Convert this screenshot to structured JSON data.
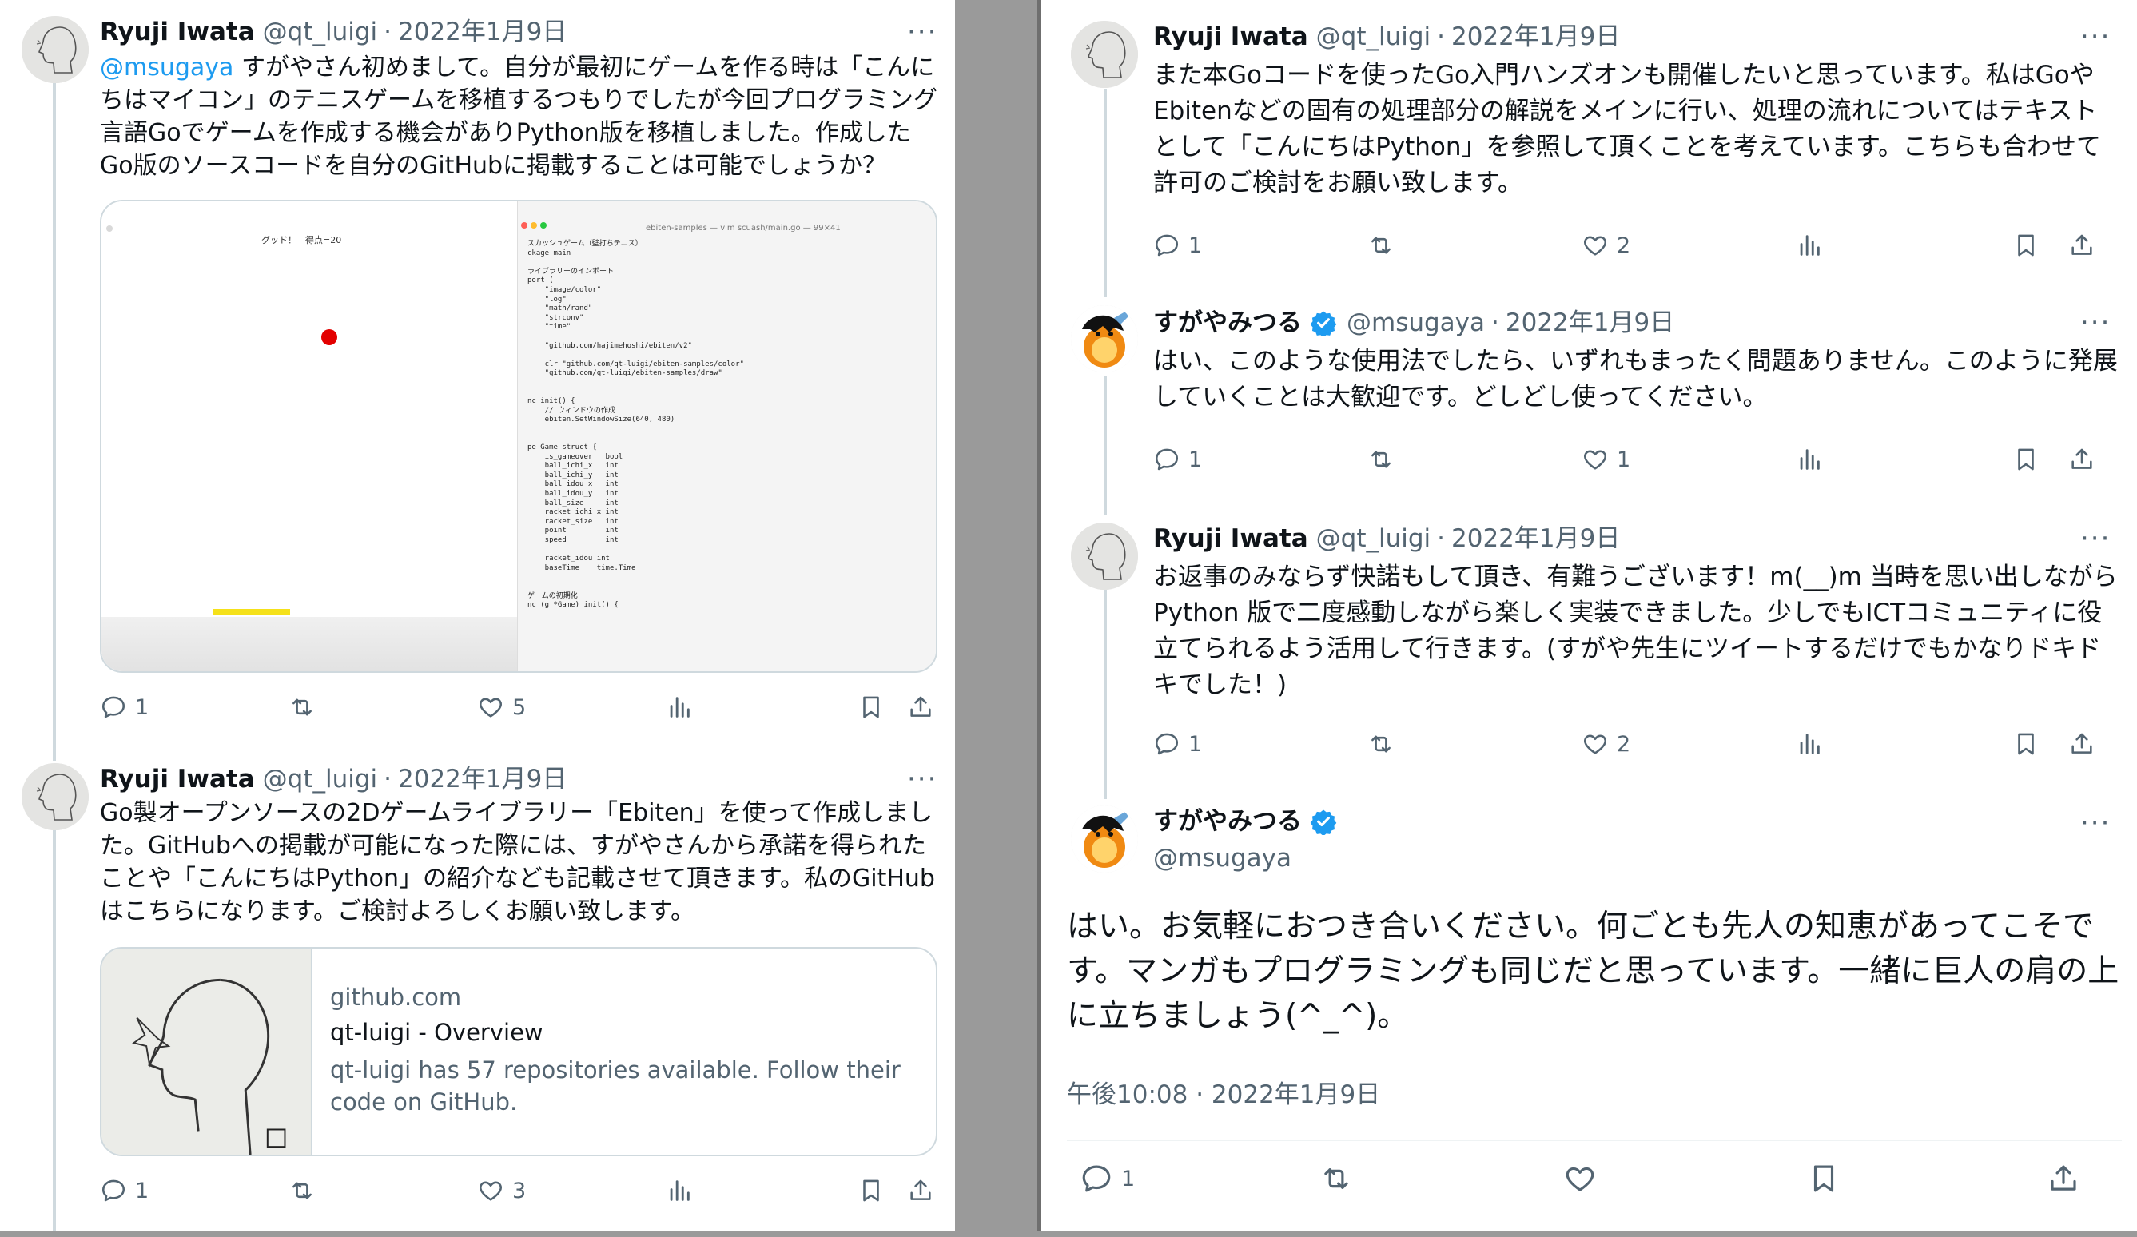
{
  "left_tweets": [
    {
      "name": "Ryuji Iwata",
      "handle": "@qt_luigi",
      "sep": "·",
      "date": "2022年1月9日",
      "mention": "@msugaya",
      "text": " すがやさん初めまして。自分が最初にゲームを作る時は「こんにちはマイコン」のテニスゲームを移植するつもりでしたが今回プログラミング言語Goでゲームを作成する機会がありPython版を移植しました。作成したGo版のソースコードを自分のGitHubに掲載することは可能でしょうか？",
      "media": {
        "game_title": "グッド！　得点=20",
        "editor_title": "ebiten-samples — vim scuash/main.go — 99×41",
        "code": "スカッシュゲーム（壁打ちテニス）\nckage main\n\nライブラリーのインポート\nport (\n    \"image/color\"\n    \"log\"\n    \"math/rand\"\n    \"strconv\"\n    \"time\"\n\n    \"github.com/hajimehoshi/ebiten/v2\"\n\n    clr \"github.com/qt-luigi/ebiten-samples/color\"\n    \"github.com/qt-luigi/ebiten-samples/draw\"\n\n\nnc init() {\n    // ウィンドウの作成\n    ebiten.SetWindowSize(640, 480)\n\n\npe Game struct {\n    is_gameover   bool\n    ball_ichi_x   int\n    ball_ichi_y   int\n    ball_idou_x   int\n    ball_idou_y   int\n    ball_size     int\n    racket_ichi_x int\n    racket_size   int\n    point         int\n    speed         int\n\n    racket_idou int\n    baseTime    time.Time\n\n\nゲームの初期化\nnc (g *Game) init() {"
      },
      "actions": {
        "reply": "1",
        "retweet": "",
        "like": "5"
      }
    },
    {
      "name": "Ryuji Iwata",
      "handle": "@qt_luigi",
      "sep": "·",
      "date": "2022年1月9日",
      "text": "Go製オープンソースの2Dゲームライブラリー「Ebiten」を使って作成しました。GitHubへの掲載が可能になった際には、すがやさんから承諾を得られたことや「こんにちはPython」の紹介なども記載させて頂きます。私のGitHubはこちらになります。ご検討よろしくお願い致します。",
      "link": {
        "domain": "github.com",
        "title": "qt-luigi - Overview",
        "desc": "qt-luigi has 57 repositories available. Follow their code on GitHub."
      },
      "actions": {
        "reply": "1",
        "retweet": "",
        "like": "3"
      }
    }
  ],
  "right_tweets": [
    {
      "name": "Ryuji Iwata",
      "handle": "@qt_luigi",
      "sep": "·",
      "date": "2022年1月9日",
      "text": "また本Goコードを使ったGo入門ハンズオンも開催したいと思っています。私はGoやEbitenなどの固有の処理部分の解説をメインに行い、処理の流れについてはテキストとして「こんにちはPython」を参照して頂くことを考えています。こちらも合わせて許可のご検討をお願い致します。",
      "actions": {
        "reply": "1",
        "retweet": "",
        "like": "2"
      }
    },
    {
      "name": "すがやみつる",
      "handle": "@msugaya",
      "sep": "·",
      "date": "2022年1月9日",
      "text": "はい、このような使用法でしたら、いずれもまったく問題ありません。このように発展していくことは大歓迎です。どしどし使ってください。",
      "actions": {
        "reply": "1",
        "retweet": "",
        "like": "1"
      }
    },
    {
      "name": "Ryuji Iwata",
      "handle": "@qt_luigi",
      "sep": "·",
      "date": "2022年1月9日",
      "text": "お返事のみならず快諾もして頂き、有難うございます！m(__)m 当時を思い出しながらPython 版で二度感動しながら楽しく実装できました。少しでもICTコミュニティに役立てられるよう活用して行きます。(すがや先生にツイートするだけでもかなりドキドキでした！)",
      "actions": {
        "reply": "1",
        "retweet": "",
        "like": "2"
      }
    }
  ],
  "main_tweet": {
    "name": "すがやみつる",
    "handle": "@msugaya",
    "text": "はい。お気軽におつき合いください。何ごとも先人の知恵があってこそです。マンガもプログラミングも同じだと思っています。一緒に巨人の肩の上に立ちましょう(^_^)。",
    "timestamp": "午後10:08 · 2022年1月9日",
    "actions": {
      "reply": "1"
    }
  },
  "icons": {
    "reply": "speech-bubble-icon",
    "retweet": "retweet-arrows-icon",
    "like": "heart-icon",
    "views": "bar-chart-icon",
    "bookmark": "bookmark-icon",
    "share": "share-upload-icon",
    "more": "ellipsis-icon",
    "verified": "verified-badge-icon"
  },
  "more_label": "···",
  "colors": {
    "link": "#1d9bf0",
    "muted": "#536471",
    "verified": "#1d9bf0",
    "divider": "#eff3f4"
  }
}
